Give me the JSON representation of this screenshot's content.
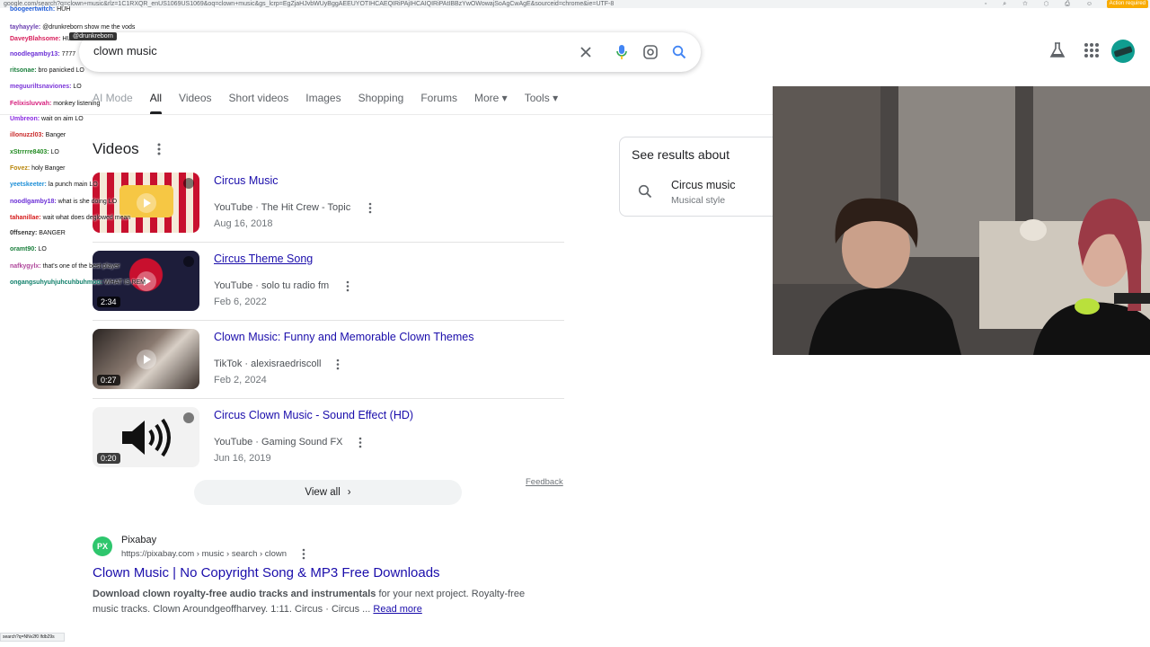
{
  "browser": {
    "url": "google.com/search?q=clown+music&rlz=1C1RXQR_enUS1069US1069&oq=clown+music&gs_lcrp=EgZjaHJvbWUyBggAEEUYOTIHCAEQIRiPAjIHCAIQIRiPAtIBBzYwOWowajSoAgCwAgE&sourceid=chrome&ie=UTF-8",
    "action_label": "Action required"
  },
  "search": {
    "query": "clown music"
  },
  "tabs": [
    "AI Mode",
    "All",
    "Videos",
    "Short videos",
    "Images",
    "Shopping",
    "Forums",
    "More",
    "Tools"
  ],
  "videos_section": {
    "heading": "Videos",
    "items": [
      {
        "title": "Circus Music",
        "source": "YouTube · The Hit Crew - Topic",
        "date": "Aug 16, 2018",
        "duration": ""
      },
      {
        "title": "Circus Theme Song",
        "source": "YouTube · solo tu radio fm",
        "date": "Feb 6, 2022",
        "duration": "2:34"
      },
      {
        "title": "Clown Music: Funny and Memorable Clown Themes",
        "source": "TikTok · alexisraedriscoll",
        "date": "Feb 2, 2024",
        "duration": "0:27"
      },
      {
        "title": "Circus Clown Music - Sound Effect (HD)",
        "source": "YouTube · Gaming Sound FX",
        "date": "Jun 16, 2019",
        "duration": "0:20"
      }
    ],
    "feedback": "Feedback",
    "view_all": "View all"
  },
  "result": {
    "site": "Pixabay",
    "url": "https://pixabay.com › music › search › clown",
    "favicon_text": "PX",
    "title": "Clown Music | No Copyright Song & MP3 Free Downloads",
    "snippet_bold": "Download clown royalty-free audio tracks and instrumentals",
    "snippet_rest": " for your next project. Royalty-free music tracks. Clown Aroundgeoffharvey. 1:11. Circus · Circus ...",
    "read_more": "Read more"
  },
  "knowledge": {
    "heading": "See results about",
    "item_title": "Circus music",
    "item_subtitle": "Musical style"
  },
  "chat": {
    "tag": "@drunkreborn",
    "lines": [
      {
        "user": "boogeertwitch:",
        "msg": " HUH",
        "color": "#1e5bd7"
      },
      {
        "user": "tayhayyle:",
        "msg": " @drunkreborn show me the vods",
        "color": "#6a3fb0"
      },
      {
        "user": "DaveyBlahsome:",
        "msg": " HUH",
        "color": "#d81e5b"
      },
      {
        "user": "noodlegamby13:",
        "msg": " 7777",
        "color": "#6b2fd6"
      },
      {
        "user": "ritsonae:",
        "msg": " bro panicked LO",
        "color": "#1a7f3c"
      },
      {
        "user": "meguuriltsnaviones:",
        "msg": " LO",
        "color": "#7b35d8"
      },
      {
        "user": "Felixisluvvah:",
        "msg": " monkey listening",
        "color": "#d61c7b"
      },
      {
        "user": "Umbreon:",
        "msg": " wait on aim LO",
        "color": "#8a2be2"
      },
      {
        "user": "illonuzzl03:",
        "msg": " Banger",
        "color": "#c92a2a"
      },
      {
        "user": "xStrrrre8403:",
        "msg": " LO",
        "color": "#228b22"
      },
      {
        "user": "Fovez:",
        "msg": " holy Banger",
        "color": "#b8860b"
      },
      {
        "user": "yeetskeeter:",
        "msg": " la punch main LO",
        "color": "#1e8fd7"
      },
      {
        "user": "noodlgamby18:",
        "msg": " what is she doing LO",
        "color": "#6b2fd6"
      },
      {
        "user": "tahanillae:",
        "msg": " wait what does deglowed mean",
        "color": "#d61c1c"
      },
      {
        "user": "0ffsenzy:",
        "msg": " BANGER",
        "color": "#333333"
      },
      {
        "user": "oramt90:",
        "msg": " LO",
        "color": "#1a7f3c"
      },
      {
        "user": "nafkygylx:",
        "msg": " that's one of the best player",
        "color": "#b0489c"
      },
      {
        "user": "ongangsuhyuhjuhcuhbuhmoo:",
        "msg": " WHAT IS REM",
        "color": "#0f7f6a"
      }
    ]
  },
  "statusbar": "search?q=NNv2f0 lfdb29s",
  "colors": {
    "link": "#1a0dab",
    "text": "#202124",
    "muted": "#70757a",
    "accent_avatar": "#0f9d90",
    "pixabay_green": "#2ec66d"
  }
}
